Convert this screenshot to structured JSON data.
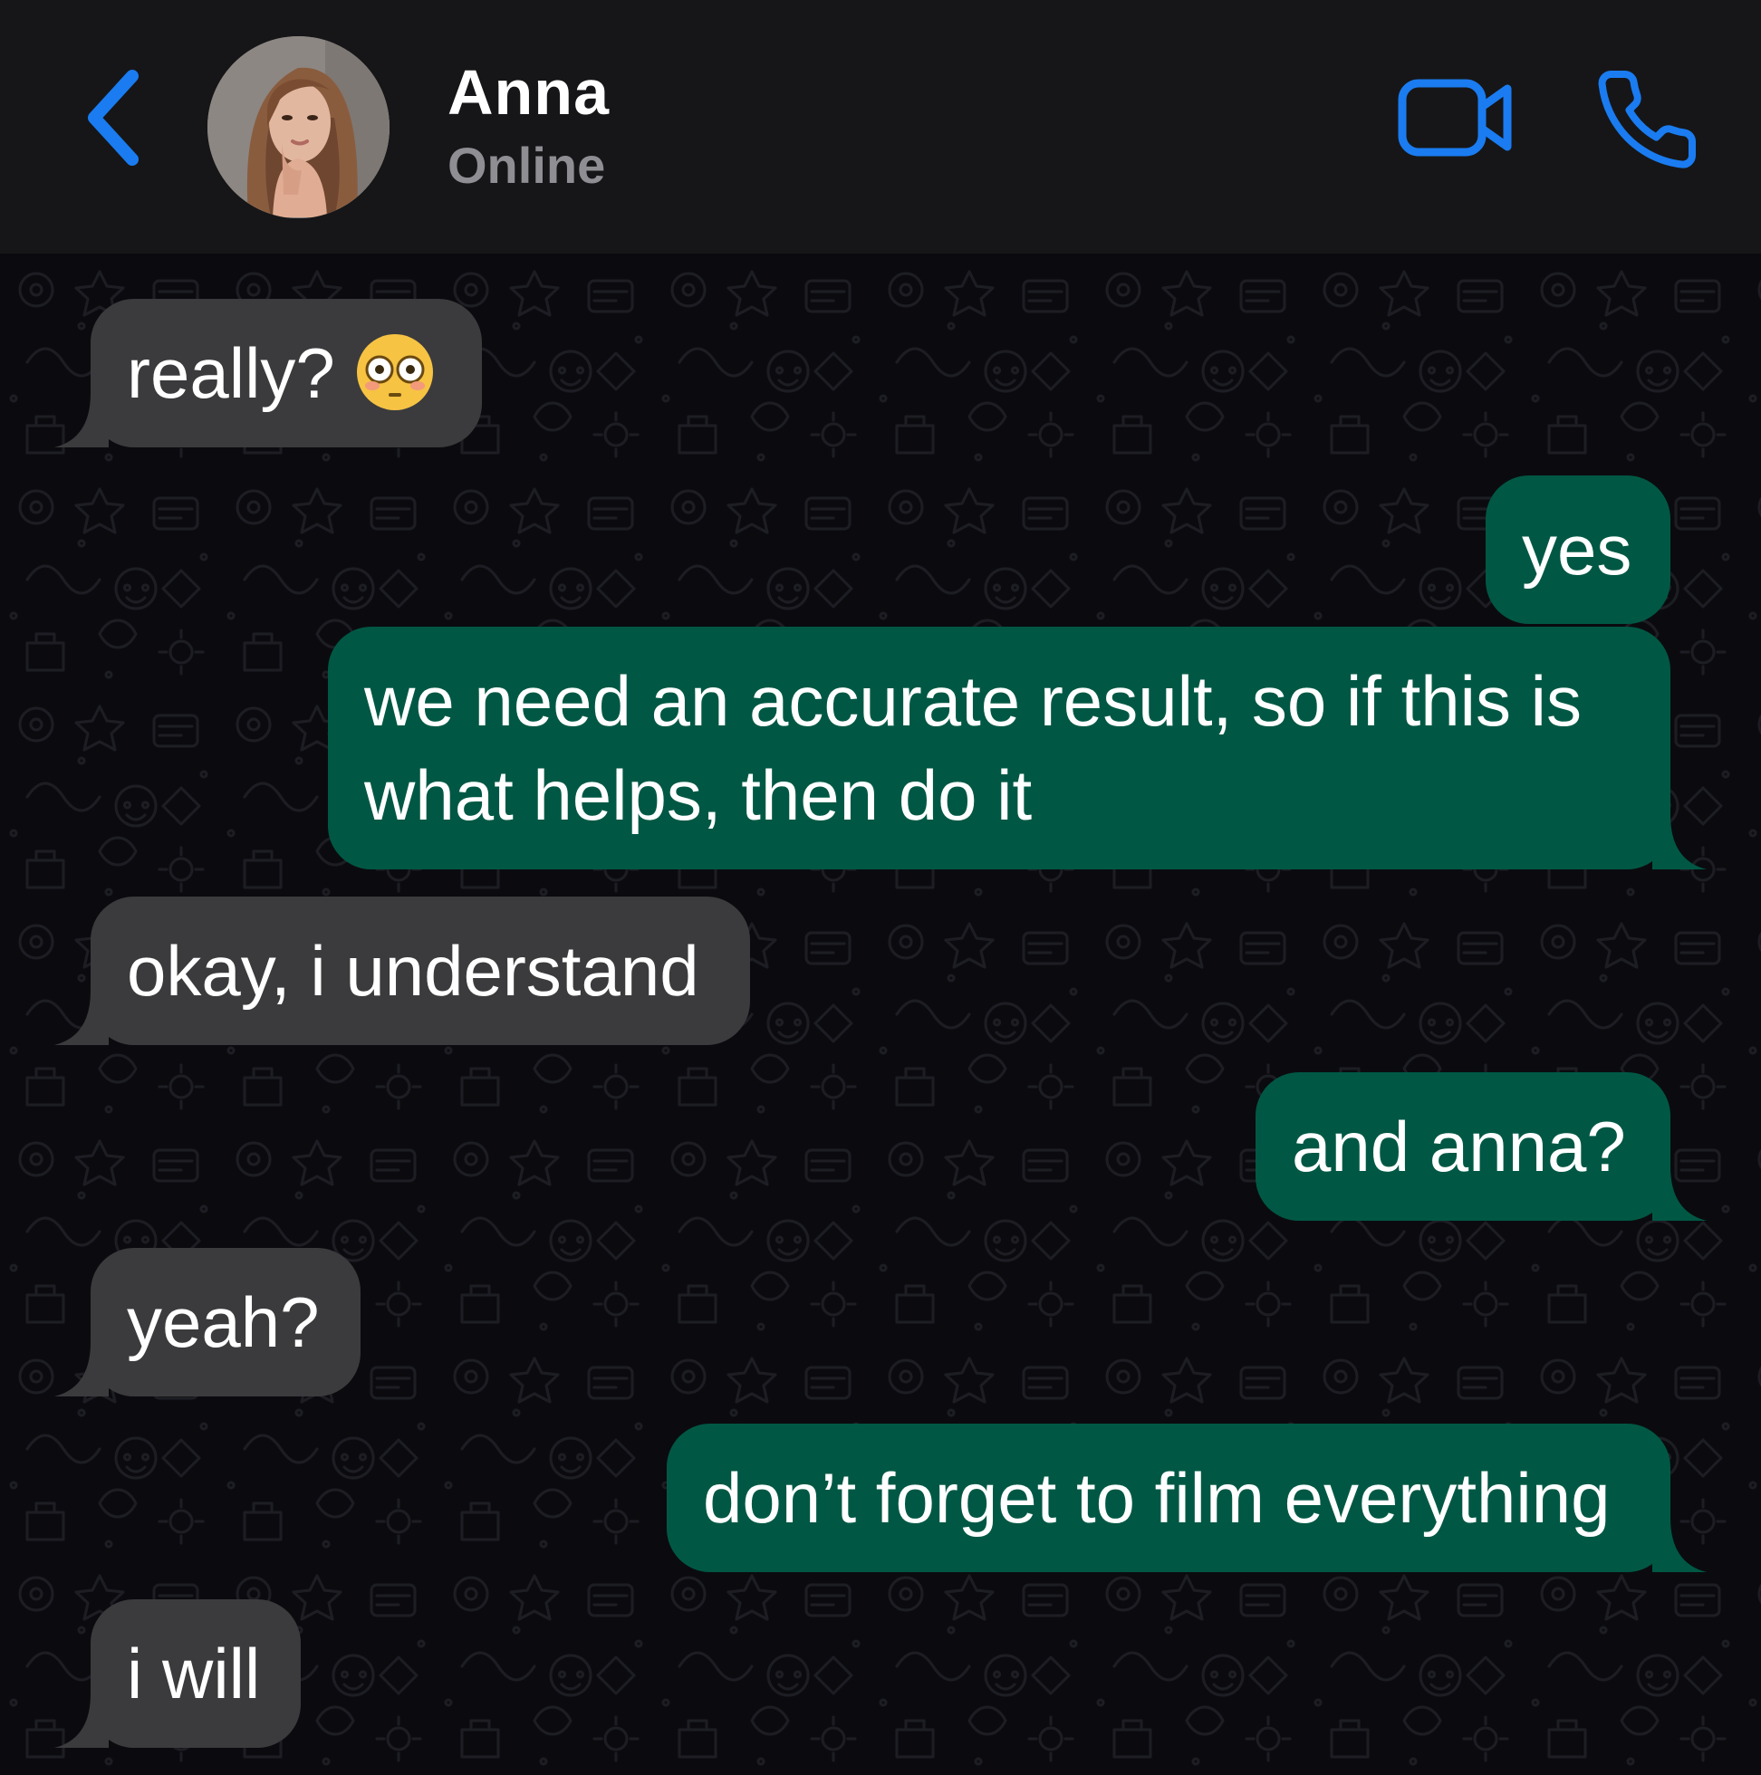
{
  "header": {
    "contact_name": "Anna",
    "contact_status": "Online",
    "back_icon": "chevron-left-icon",
    "video_icon": "video-camera-icon",
    "call_icon": "phone-icon"
  },
  "theme": {
    "accent": "#1a7cf0",
    "incoming_bubble": "#3b3b3d",
    "outgoing_bubble": "#005844",
    "chat_background": "#0b0b0f",
    "header_background": "#161618"
  },
  "messages": [
    {
      "direction": "incoming",
      "text": "really?",
      "emoji": "flushed-face"
    },
    {
      "direction": "outgoing",
      "text": "yes"
    },
    {
      "direction": "outgoing",
      "line1": "we need an accurate result, so if this is",
      "line2": "what helps, then do it"
    },
    {
      "direction": "incoming",
      "text": "okay, i understand"
    },
    {
      "direction": "outgoing",
      "text": "and anna?"
    },
    {
      "direction": "incoming",
      "text": "yeah?"
    },
    {
      "direction": "outgoing",
      "text": "don’t forget to film everything"
    },
    {
      "direction": "incoming",
      "text": "i will"
    }
  ]
}
